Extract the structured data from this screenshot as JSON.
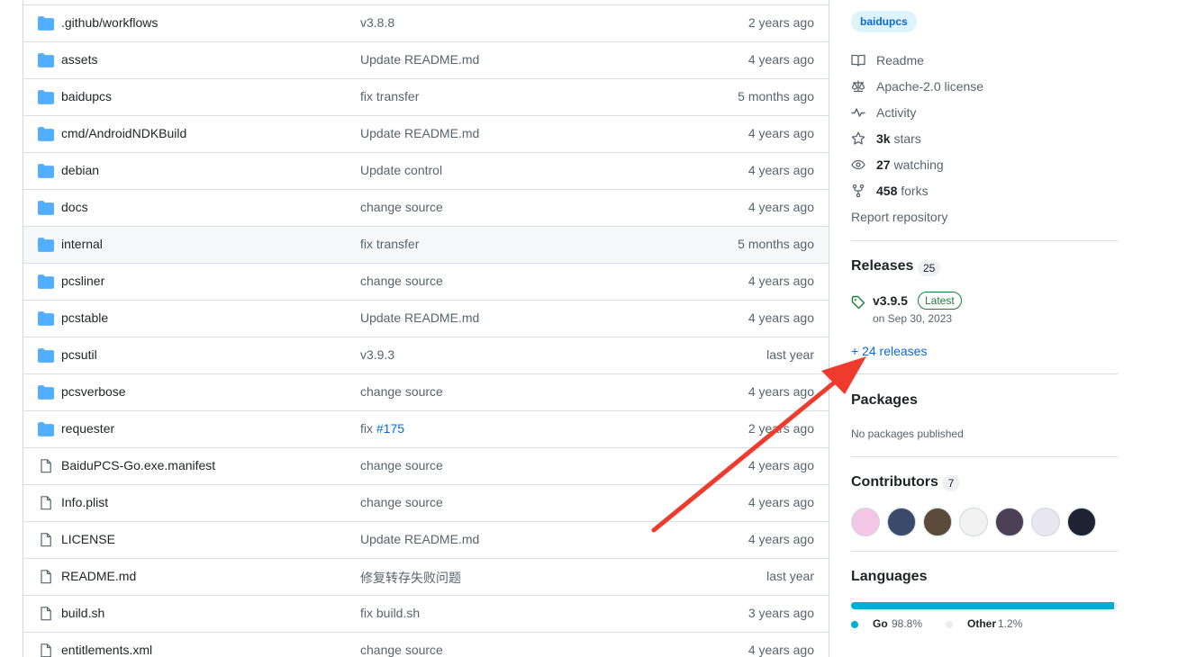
{
  "files": [
    {
      "name": ".github/workflows",
      "type": "folder",
      "message": "v3.8.8",
      "date": "2 years ago"
    },
    {
      "name": "assets",
      "type": "folder",
      "message": "Update README.md",
      "date": "4 years ago"
    },
    {
      "name": "baidupcs",
      "type": "folder",
      "message": "fix transfer",
      "date": "5 months ago"
    },
    {
      "name": "cmd/AndroidNDKBuild",
      "type": "folder",
      "message": "Update README.md",
      "date": "4 years ago"
    },
    {
      "name": "debian",
      "type": "folder",
      "message": "Update control",
      "date": "4 years ago"
    },
    {
      "name": "docs",
      "type": "folder",
      "message": "change source",
      "date": "4 years ago"
    },
    {
      "name": "internal",
      "type": "folder",
      "message": "fix transfer",
      "date": "5 months ago",
      "hover": true
    },
    {
      "name": "pcsliner",
      "type": "folder",
      "message": "change source",
      "date": "4 years ago"
    },
    {
      "name": "pcstable",
      "type": "folder",
      "message": "Update README.md",
      "date": "4 years ago"
    },
    {
      "name": "pcsutil",
      "type": "folder",
      "message": "v3.9.3",
      "date": "last year"
    },
    {
      "name": "pcsverbose",
      "type": "folder",
      "message": "change source",
      "date": "4 years ago"
    },
    {
      "name": "requester",
      "type": "folder",
      "message": "fix ",
      "message_link": "#175",
      "date": "2 years ago"
    },
    {
      "name": "BaiduPCS-Go.exe.manifest",
      "type": "file",
      "message": "change source",
      "date": "4 years ago"
    },
    {
      "name": "Info.plist",
      "type": "file",
      "message": "change source",
      "date": "4 years ago"
    },
    {
      "name": "LICENSE",
      "type": "file",
      "message": "Update README.md",
      "date": "4 years ago"
    },
    {
      "name": "README.md",
      "type": "file",
      "message": "修复转存失败问题",
      "date": "last year"
    },
    {
      "name": "build.sh",
      "type": "file",
      "message": "fix build.sh",
      "date": "3 years ago"
    },
    {
      "name": "entitlements.xml",
      "type": "file",
      "message": "change source",
      "date": "4 years ago"
    }
  ],
  "sidebar": {
    "topic": "baidupcs",
    "about": {
      "readme": "Readme",
      "license": "Apache-2.0 license",
      "activity": "Activity",
      "stars_count": "3k",
      "stars_label": " stars",
      "watching_count": "27",
      "watching_label": " watching",
      "forks_count": "458",
      "forks_label": " forks",
      "report": "Report repository"
    },
    "releases": {
      "title": "Releases",
      "count": "25",
      "latest_version": "v3.9.5",
      "latest_badge": "Latest",
      "latest_date": "on Sep 30, 2023",
      "more": "+ 24 releases"
    },
    "packages": {
      "title": "Packages",
      "empty": "No packages published"
    },
    "contributors": {
      "title": "Contributors",
      "count": "7",
      "avatars": [
        "#f3c6e4",
        "#3a4a6b",
        "#5a4a3a",
        "#f2f2f2",
        "#4a3f55",
        "#e8e6f0",
        "#1e2233"
      ]
    },
    "languages": {
      "title": "Languages",
      "items": [
        {
          "name": "Go",
          "percent": "98.8%",
          "value": 98.8,
          "color": "#00ADD8"
        },
        {
          "name": "Other",
          "percent": "1.2%",
          "value": 1.2,
          "color": "#ededed"
        }
      ]
    }
  },
  "colors": {
    "annotation_arrow": "#ee3b2e",
    "folder": "#54aeff",
    "link": "#0969da"
  }
}
